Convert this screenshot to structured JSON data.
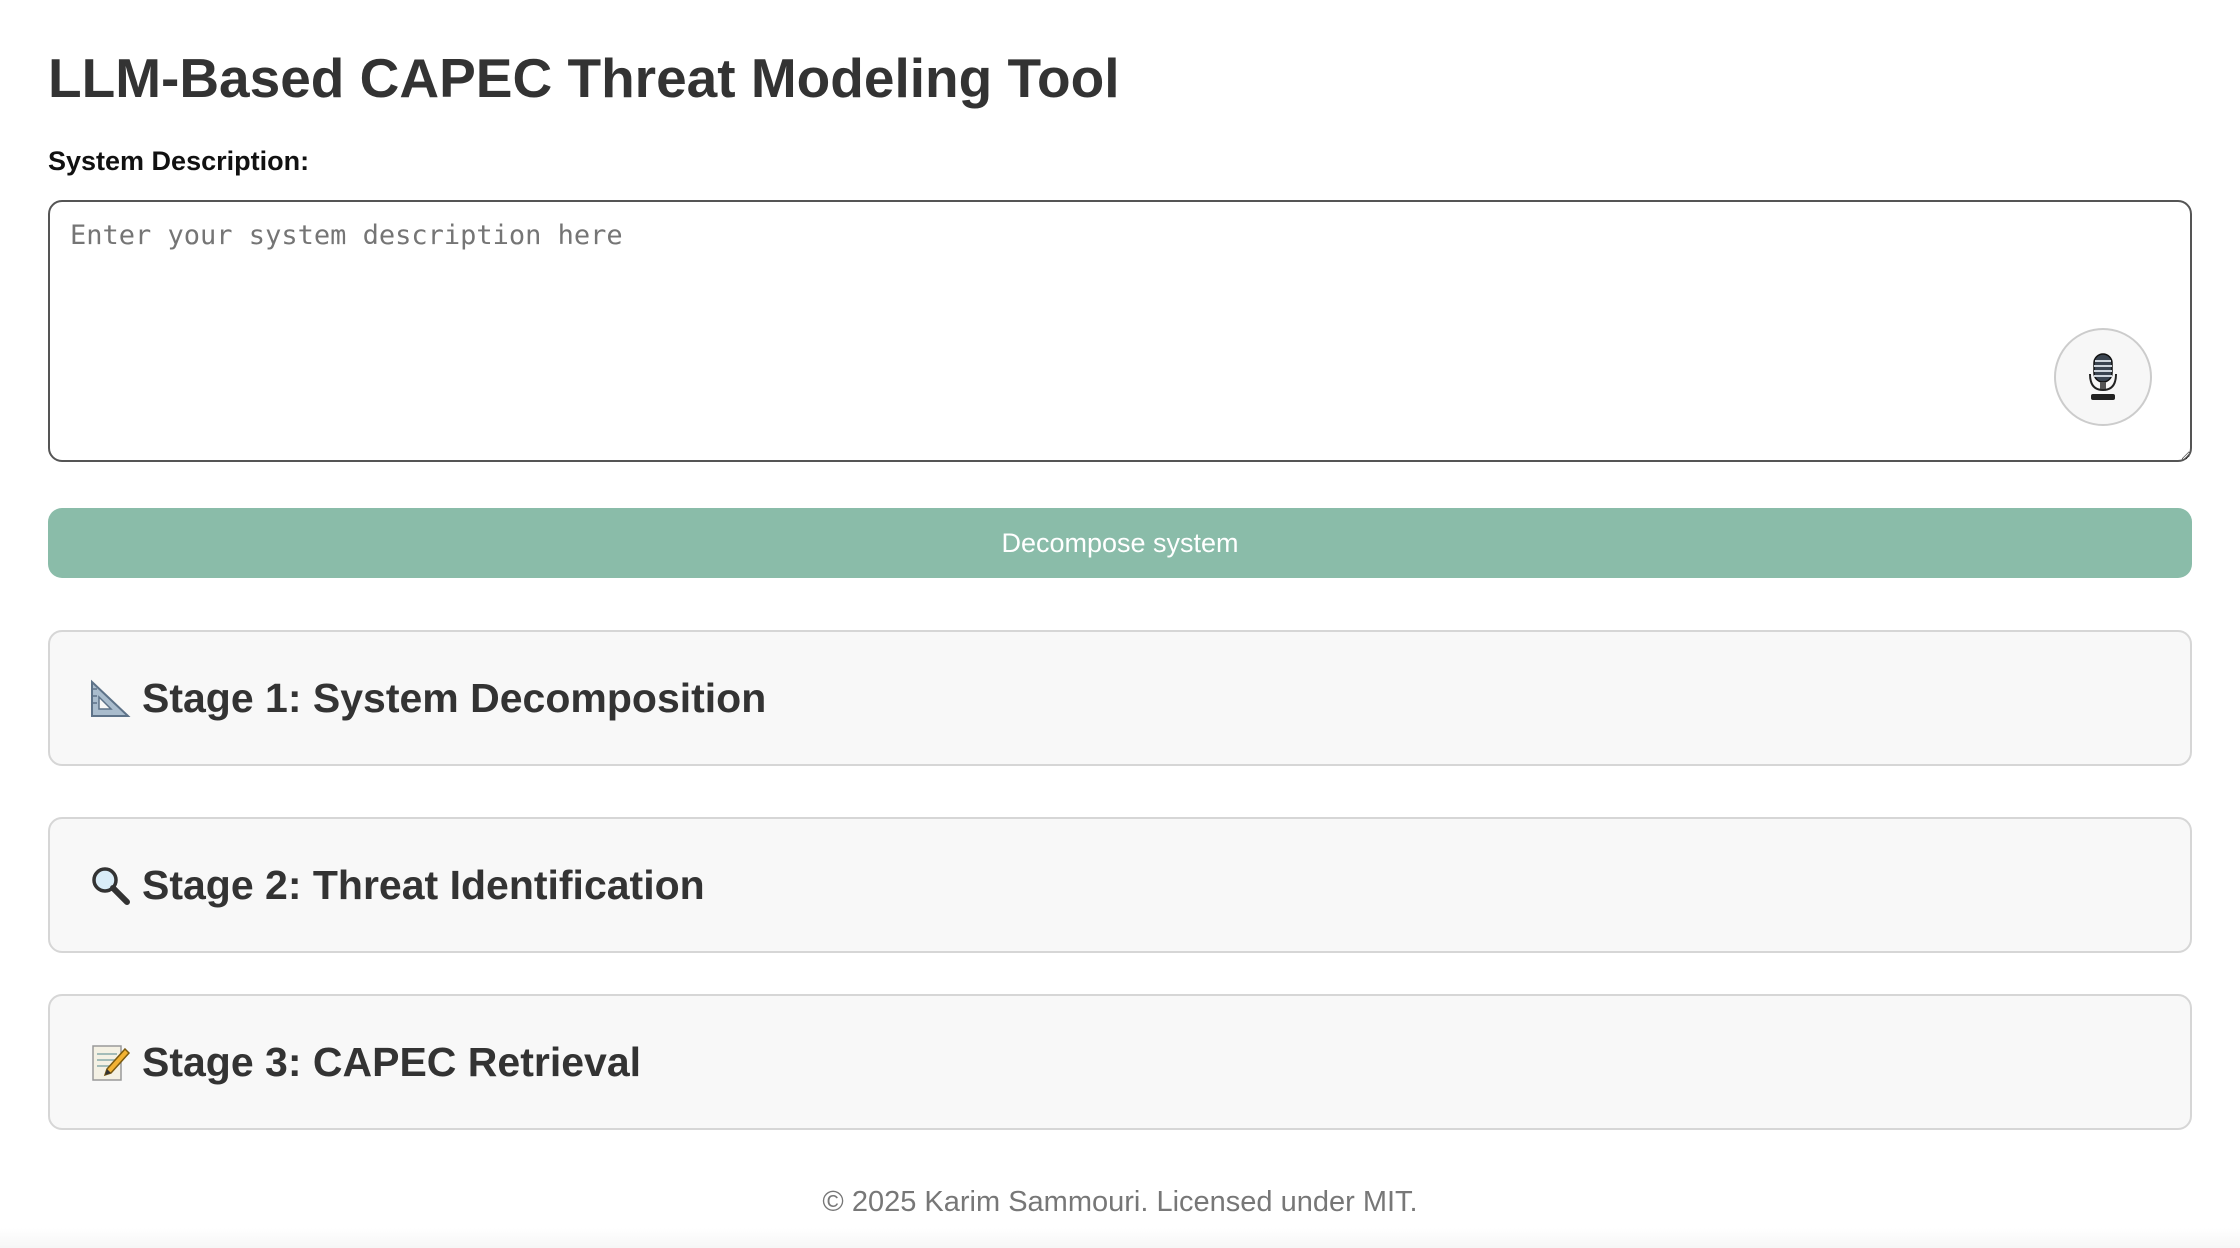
{
  "header": {
    "title": "LLM-Based CAPEC Threat Modeling Tool"
  },
  "form": {
    "label": "System Description:",
    "placeholder": "Enter your system description here",
    "value": "",
    "mic_icon": "microphone-icon",
    "submit_label": "Decompose system",
    "submit_color": "#8abca9"
  },
  "stages": [
    {
      "icon": "triangular-ruler-icon",
      "title": "Stage 1: System Decomposition"
    },
    {
      "icon": "magnifying-glass-icon",
      "title": "Stage 2: Threat Identification"
    },
    {
      "icon": "memo-icon",
      "title": "Stage 3: CAPEC Retrieval"
    }
  ],
  "footer": {
    "text": "© 2025 Karim Sammouri. Licensed under MIT."
  }
}
